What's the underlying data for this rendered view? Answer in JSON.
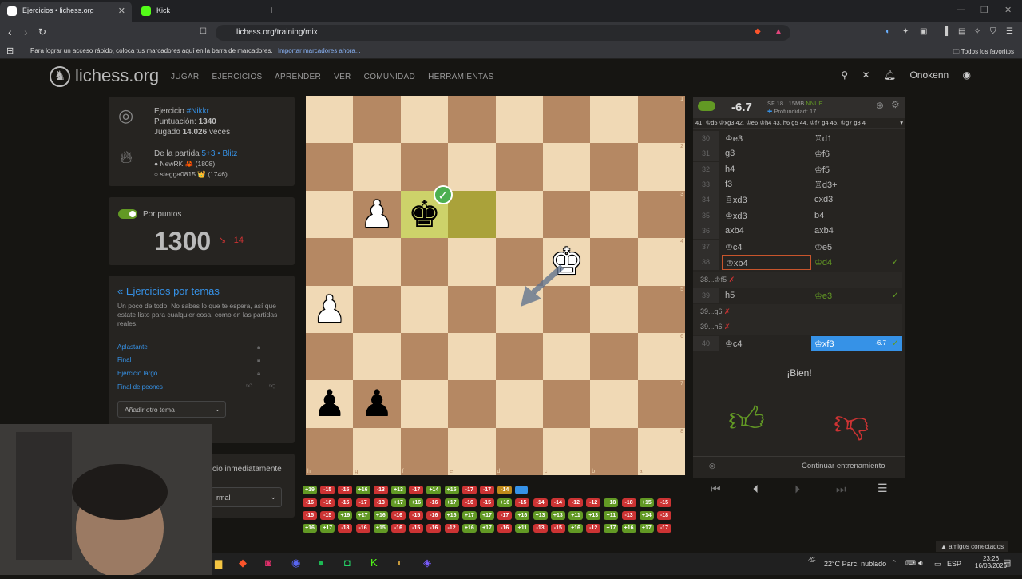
{
  "browser": {
    "tabs": [
      {
        "title": "Ejercicios • lichess.org",
        "icon_color": "#ffffff"
      },
      {
        "title": "Kick",
        "icon_color": "#53fc18"
      }
    ],
    "url": "lichess.org/training/mix",
    "bookmarks_msg": "Para lograr un acceso rápido, coloca tus marcadores aquí en la barra de marcadores.",
    "bookmarks_link": "Importar marcadores ahora...",
    "favorites": "Todos los favoritos"
  },
  "header": {
    "logo": "lichess.org",
    "nav": [
      "JUGAR",
      "EJERCICIOS",
      "APRENDER",
      "VER",
      "COMUNIDAD",
      "HERRAMIENTAS"
    ],
    "user": "Onokenn"
  },
  "puzzle": {
    "label": "Ejercicio",
    "id": "#Nikkr",
    "rating_label": "Puntuación:",
    "rating": "1340",
    "played_label": "Jugado",
    "played": "14.026",
    "played_suffix": "veces",
    "game_label": "De la partida",
    "game_type": "5+3 • Blitz",
    "player1": "NewRK 🦀 (1808)",
    "player2": "stegga0815 👑 (1746)"
  },
  "rating_box": {
    "toggle_label": "Por puntos",
    "rating": "1300",
    "delta": "−14"
  },
  "themes": {
    "title": "« Ejercicios por temas",
    "desc": "Un poco de todo. No sabes lo que te espera, así que estate listo para cualquier cosa, como en las partidas reales.",
    "items": [
      "Aplastante",
      "Final",
      "Ejercicio largo",
      "Final de peones"
    ],
    "select": "Añadir otro tema"
  },
  "partial": {
    "text": "cio inmediatamente",
    "select": "rmal"
  },
  "ceval": {
    "score": "-6.7",
    "engine": "SF 18 · 15MB",
    "nnue": "NNUE",
    "depth": "Profundidad: 17",
    "line": "41. ♔d5 ♔xg3 42. ♔e6 ♔h4 43. h6 g5 44. ♔f7 g4 45. ♔g7 g3 4"
  },
  "moves": [
    {
      "n": "30",
      "w": "♔e3",
      "b": "♖d1"
    },
    {
      "n": "31",
      "w": "g3",
      "b": "♔f6"
    },
    {
      "n": "32",
      "w": "h4",
      "b": "♔f5"
    },
    {
      "n": "33",
      "w": "f3",
      "b": "♖d3+"
    },
    {
      "n": "34",
      "w": "♖xd3",
      "b": "cxd3"
    },
    {
      "n": "35",
      "w": "♔xd3",
      "b": "b4"
    },
    {
      "n": "36",
      "w": "axb4",
      "b": "axb4"
    },
    {
      "n": "37",
      "w": "♔c4",
      "b": "♔e5"
    },
    {
      "n": "38",
      "w": "♔xb4",
      "b": "♔d4"
    },
    {
      "n": "39",
      "w": "h5",
      "b": "♔e3"
    },
    {
      "n": "40",
      "w": "♔c4",
      "b": "♔xf3"
    }
  ],
  "variations": [
    "38...♔f5 ✗",
    "39...g6 ✗",
    "39...h6 ✗"
  ],
  "final_eval": "-6.7",
  "feedback": {
    "good": "¡Bien!",
    "continue": "Continuar entrenamiento"
  },
  "history": {
    "row1": [
      "+19",
      "-15",
      "-15",
      "+16",
      "-13",
      "+13",
      "-17",
      "+14",
      "+15",
      "-17",
      "-17",
      "-14",
      ""
    ],
    "row2": [
      "-16",
      "-16",
      "-15",
      "-17",
      "-13",
      "+17",
      "+16",
      "-16",
      "+17",
      "-16",
      "-15",
      "+16",
      "-15",
      "-14",
      "-14",
      "-12",
      "-12",
      "+18",
      "-18",
      "+15",
      "-15"
    ],
    "row3": [
      "-15",
      "-15",
      "+19",
      "+17",
      "+16",
      "-16",
      "-15",
      "-16",
      "+16",
      "+17",
      "+17",
      "-17",
      "+16",
      "+13",
      "+13",
      "+11",
      "+13",
      "+11",
      "-13",
      "+14",
      "-18"
    ],
    "row4": [
      "+16",
      "+17",
      "-18",
      "-16",
      "+15",
      "-16",
      "-15",
      "-16",
      "-12",
      "+16",
      "+17",
      "-16",
      "+11",
      "-13",
      "-15",
      "+16",
      "-12",
      "+17",
      "+16",
      "+17",
      "-17"
    ]
  },
  "taskbar": {
    "weather": "22°C  Parc. nublado",
    "lang": "ESP",
    "time": "23:26",
    "date": "16/03/2026"
  },
  "friends": "▲ amigos conectados",
  "board": {
    "ranks": [
      "1",
      "2",
      "3",
      "4",
      "5",
      "6",
      "7",
      "8"
    ],
    "files": [
      "h",
      "g",
      "f",
      "e",
      "d",
      "c",
      "b",
      "a"
    ],
    "pieces": {
      "2,1": "♟",
      "2,2": "♚",
      "3,5": "♔",
      "4,0": "♟",
      "6,0": "♟",
      "6,1": "♟"
    }
  },
  "colors": {
    "accent": "#629924",
    "link": "#3692e7",
    "bad": "#cc3333"
  }
}
